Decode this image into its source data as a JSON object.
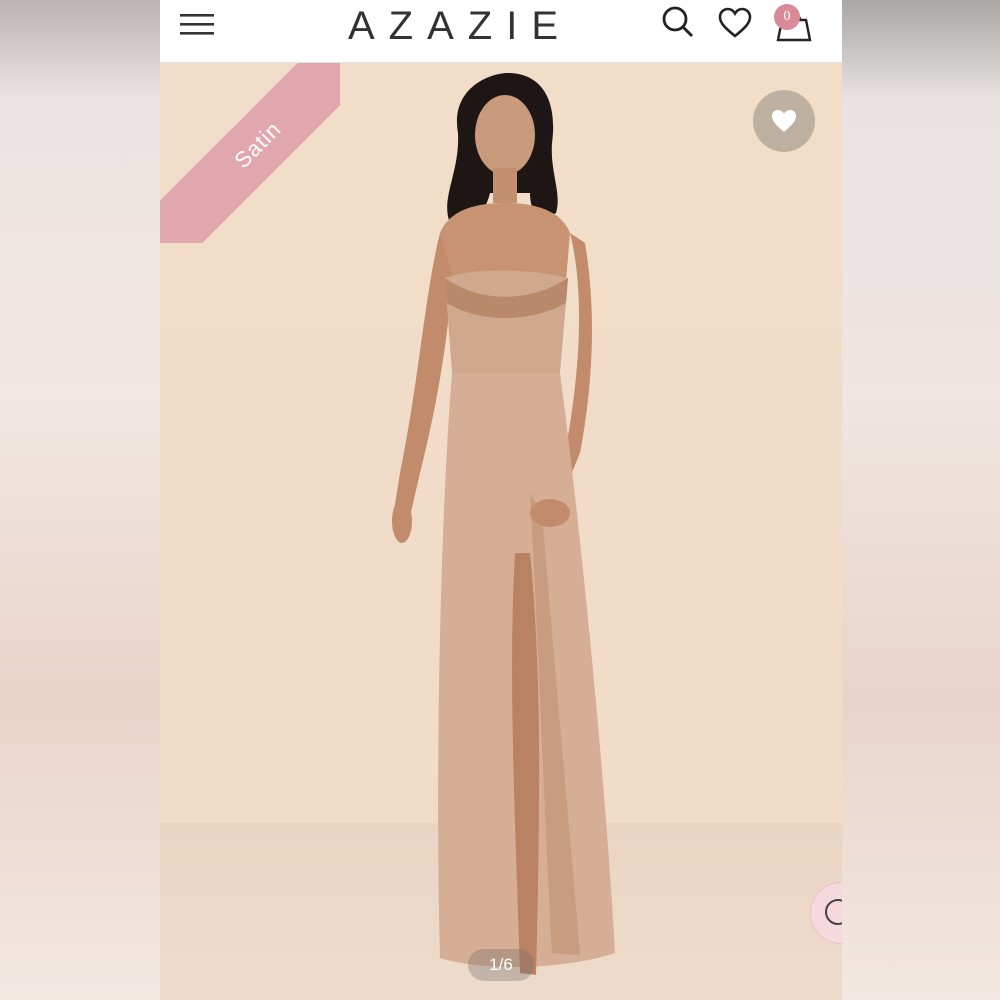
{
  "header": {
    "brand": "AZAZIE",
    "cart_count": "0"
  },
  "hero": {
    "badge": "Satin",
    "pager": "1/6"
  },
  "icons": [
    "menu-icon",
    "search-icon",
    "heart-icon",
    "bag-icon",
    "heart-icon",
    "chat-icon"
  ],
  "colors": {
    "badge": "#e0a7ae",
    "cart_badge": "#d88a98",
    "background": "#f1ddc8",
    "dress": "#d9b39c"
  }
}
